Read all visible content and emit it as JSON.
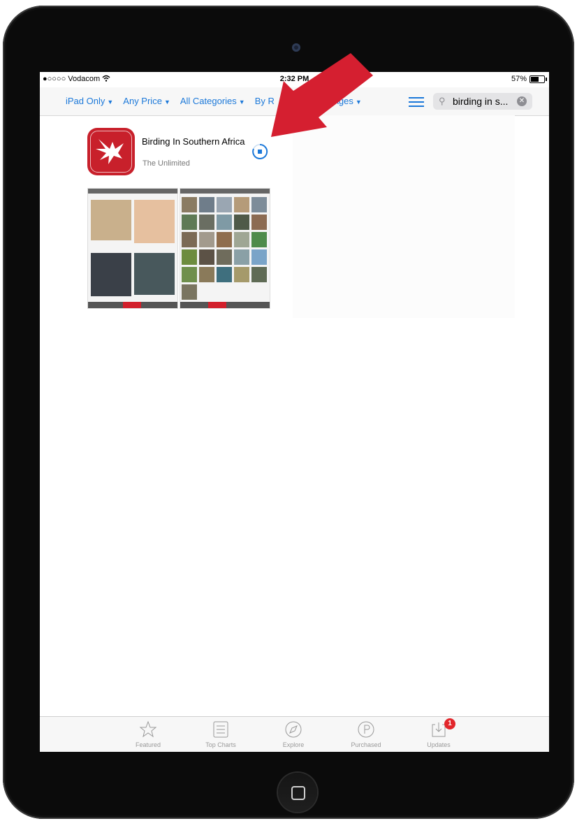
{
  "status_bar": {
    "carrier": "●○○○○ Vodacom",
    "time": "2:32 PM",
    "battery": "57%"
  },
  "filters": [
    {
      "label": "iPad Only"
    },
    {
      "label": "Any Price"
    },
    {
      "label": "All Categories"
    },
    {
      "label": "By R"
    },
    {
      "label": "All Ages"
    }
  ],
  "search": {
    "value": "birding in s..."
  },
  "result": {
    "name": "Birding In Southern Africa",
    "developer": "The Unlimited",
    "brand_color": "#c8202b"
  },
  "tabs": [
    {
      "label": "Featured",
      "icon": "star-icon"
    },
    {
      "label": "Top Charts",
      "icon": "list-icon"
    },
    {
      "label": "Explore",
      "icon": "compass-icon"
    },
    {
      "label": "Purchased",
      "icon": "purchased-icon"
    },
    {
      "label": "Updates",
      "icon": "updates-icon",
      "badge": "1"
    }
  ],
  "accent_color": "#1b78d9",
  "annotation_arrow_color": "#d51f30"
}
